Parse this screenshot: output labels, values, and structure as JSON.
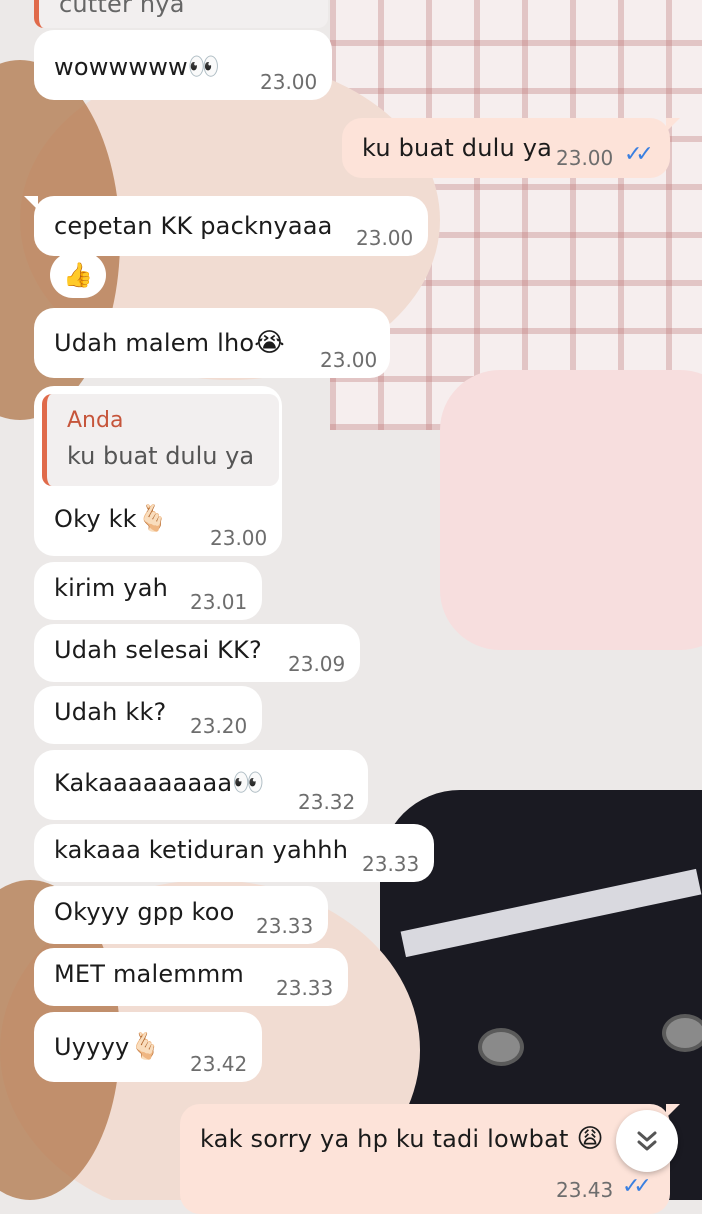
{
  "chat": {
    "messages": [
      {
        "partial_text": "cutter nya"
      },
      {
        "text": "wowwwww",
        "emoji": "👀",
        "time": "23.00"
      },
      {
        "text": "ku buat dulu ya",
        "time": "23.00",
        "ticks": "✓✓"
      },
      {
        "text": "cepetan KK packnyaaa",
        "time": "23.00"
      },
      {
        "reaction": "👍"
      },
      {
        "text": "Udah malem lho",
        "emoji": "😭",
        "time": "23.00"
      },
      {
        "quote_name": "Anda",
        "quote_text": "ku buat dulu ya",
        "text": "Oky kk",
        "emoji": "🫰🏻",
        "time": "23.00"
      },
      {
        "text": "kirim yah",
        "time": "23.01"
      },
      {
        "text": "Udah selesai KK?",
        "time": "23.09"
      },
      {
        "text": "Udah kk?",
        "time": "23.20"
      },
      {
        "text": "Kakaaaaaaaaa",
        "emoji": "👀",
        "time": "23.32"
      },
      {
        "text": "kakaaa ketiduran yahhh",
        "time": "23.33"
      },
      {
        "text": "Okyyy gpp koo",
        "time": "23.33"
      },
      {
        "text": "MET malemmm",
        "time": "23.33"
      },
      {
        "text": "Uyyyy",
        "emoji": "🫰🏻",
        "time": "23.42"
      },
      {
        "text": "kak sorry ya hp ku tadi lowbat",
        "emoji": "😩",
        "time": "23.43",
        "ticks": "✓✓"
      }
    ],
    "scroll_down_icon": "double-chevron-down-icon"
  },
  "colors": {
    "incoming_bubble": "#ffffff",
    "outgoing_bubble": "#fde3d9",
    "read_ticks": "#3a7fe0",
    "quote_accent": "#e06a4a"
  }
}
